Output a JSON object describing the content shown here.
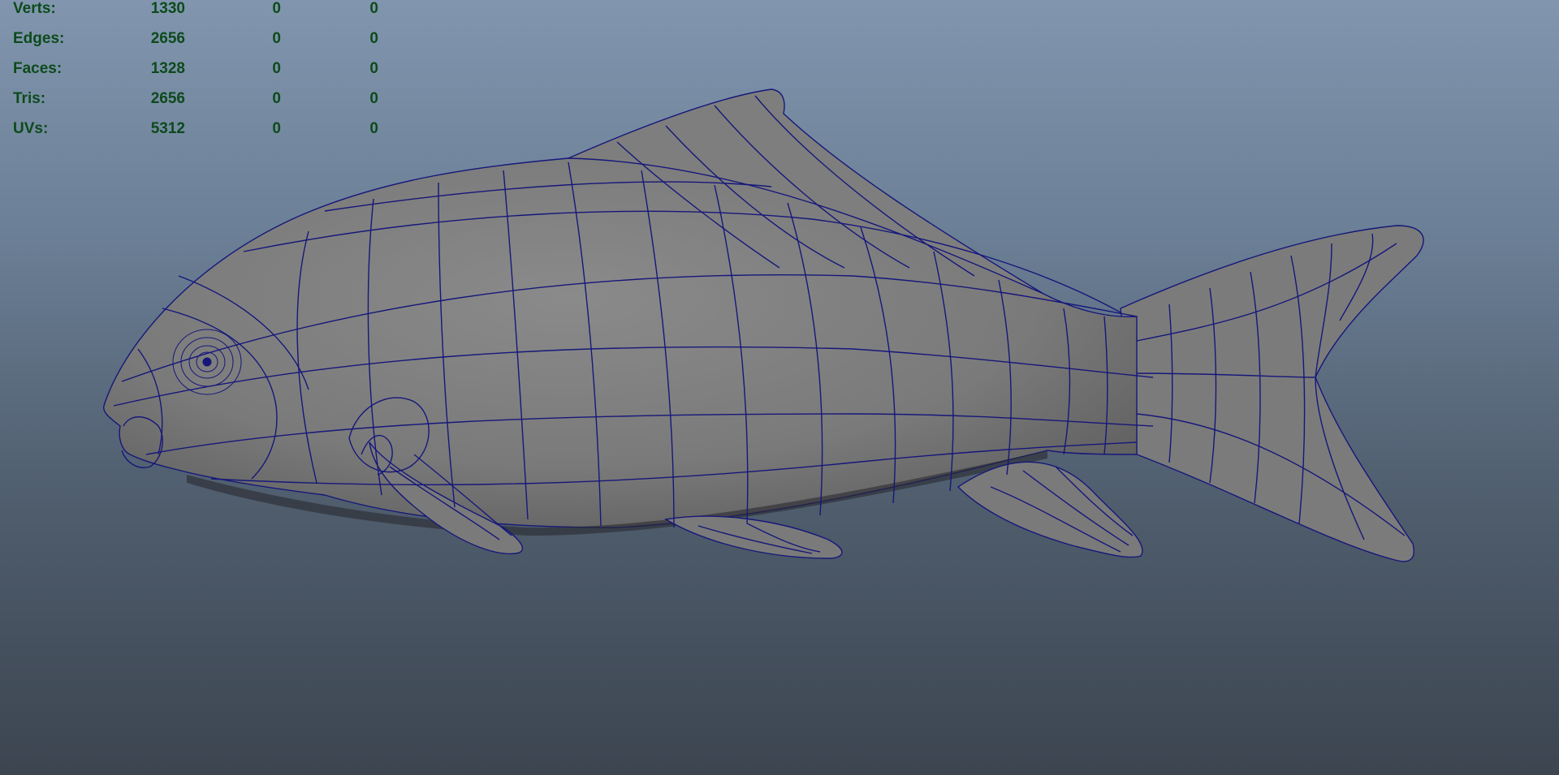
{
  "viewport": {
    "background_top": "#8196ae",
    "background_bottom": "#3c4550",
    "wire_color": "#16177a",
    "mesh_fill": "#7c7c7c"
  },
  "stats": {
    "text_color": "#0d4a1c",
    "rows": [
      {
        "label": "Verts:",
        "values": [
          "1330",
          "0",
          "0"
        ]
      },
      {
        "label": "Edges:",
        "values": [
          "2656",
          "0",
          "0"
        ]
      },
      {
        "label": "Faces:",
        "values": [
          "1328",
          "0",
          "0"
        ]
      },
      {
        "label": "Tris:",
        "values": [
          "2656",
          "0",
          "0"
        ]
      },
      {
        "label": "UVs:",
        "values": [
          "5312",
          "0",
          "0"
        ]
      }
    ]
  },
  "model": {
    "name_icon": "koi-fish-wireframe-mesh"
  }
}
